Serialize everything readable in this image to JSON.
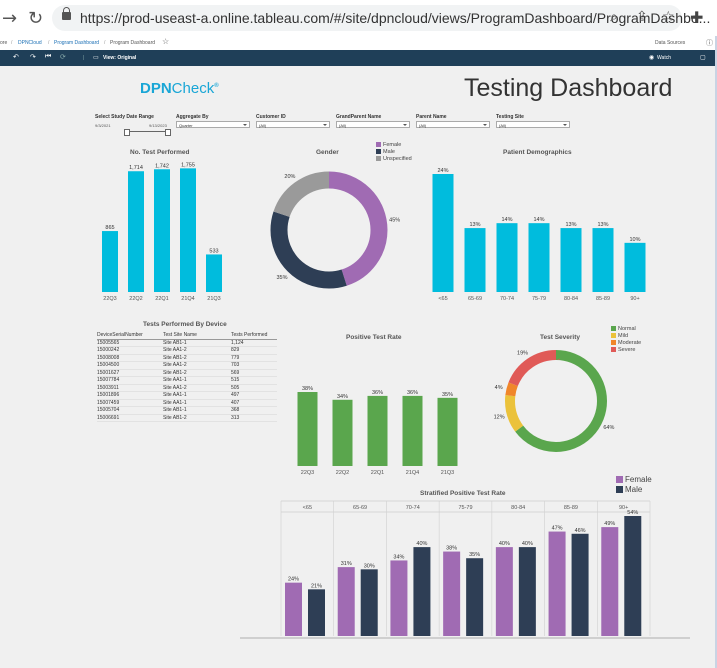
{
  "browser": {
    "url": "https://prod-useast-a.online.tableau.com/#/site/dpncloud/views/ProgramDashboard/ProgramDashbo..."
  },
  "breadcrumb": {
    "items": [
      "ore",
      "DPNCloud",
      "Program Dashboard",
      "Program Dashboard"
    ],
    "data_sources": "Data Sources"
  },
  "toolbar": {
    "view_label": "View: Original",
    "watch_label": "Watch"
  },
  "header": {
    "logo_a": "DPN",
    "logo_b": "Check",
    "logo_mark": "®",
    "title": "Testing Dashboard"
  },
  "filters": {
    "date_range": {
      "label": "Select Study Date Range",
      "start": "9/3/2021",
      "end": "9/13/2023"
    },
    "aggregate": {
      "label": "Aggregate By",
      "value": "Quarter"
    },
    "customer": {
      "label": "Customer ID",
      "value": "(All)"
    },
    "grandparent": {
      "label": "GrandParent Name",
      "value": "(All)"
    },
    "parent": {
      "label": "Parent Name",
      "value": "(All)"
    },
    "site": {
      "label": "Testing Site",
      "value": "(All)"
    }
  },
  "colors": {
    "cyan": "#00bcdd",
    "green": "#5aa64d",
    "purple": "#a06bb3",
    "navy": "#2e3e55",
    "gray": "#9a9a9a",
    "yellow": "#ebc23b",
    "orange": "#f0862a",
    "red": "#e05a57"
  },
  "chart_data": [
    {
      "id": "tests",
      "type": "bar",
      "title": "No. Test Performed",
      "categories": [
        "22Q3",
        "22Q2",
        "22Q1",
        "21Q4",
        "21Q3"
      ],
      "values": [
        865,
        1714,
        1742,
        1755,
        533
      ],
      "labels": [
        "865",
        "1,714",
        "1,742",
        "1,755",
        "533"
      ]
    },
    {
      "id": "gender",
      "type": "pie",
      "title": "Gender",
      "categories": [
        "Female",
        "Male",
        "Unspecified"
      ],
      "values": [
        45,
        35,
        20
      ],
      "labels": [
        "45%",
        "35%",
        "20%"
      ]
    },
    {
      "id": "demographics",
      "type": "bar",
      "title": "Patient Demographics",
      "categories": [
        "<65",
        "65-69",
        "70-74",
        "75-79",
        "80-84",
        "85-89",
        "90+"
      ],
      "values": [
        24,
        13,
        14,
        14,
        13,
        13,
        10
      ],
      "labels": [
        "24%",
        "13%",
        "14%",
        "14%",
        "13%",
        "13%",
        "10%"
      ]
    },
    {
      "id": "device",
      "type": "table",
      "title": "Tests Performed By Device",
      "columns": [
        "DeviceSerialNumber",
        "Test Site Name",
        "Tests Performed"
      ],
      "rows": [
        [
          "15005565",
          "Site AB1-1",
          "1,124"
        ],
        [
          "15000242",
          "Site AA1-2",
          "829"
        ],
        [
          "15008008",
          "Site AB1-2",
          "779"
        ],
        [
          "15004500",
          "Site AA1-2",
          "703"
        ],
        [
          "15001627",
          "Site AB1-2",
          "569"
        ],
        [
          "15007784",
          "Site AA1-1",
          "515"
        ],
        [
          "15003911",
          "Site AA1-2",
          "505"
        ],
        [
          "15001896",
          "Site AA1-1",
          "497"
        ],
        [
          "15007459",
          "Site AA1-1",
          "407"
        ],
        [
          "15005704",
          "Site AB1-1",
          "368"
        ],
        [
          "15006691",
          "Site AB1-2",
          "313"
        ]
      ]
    },
    {
      "id": "positive",
      "type": "bar",
      "title": "Positive Test Rate",
      "categories": [
        "22Q3",
        "22Q2",
        "22Q1",
        "21Q4",
        "21Q3"
      ],
      "values": [
        38,
        34,
        36,
        36,
        35
      ],
      "labels": [
        "38%",
        "34%",
        "36%",
        "36%",
        "35%"
      ]
    },
    {
      "id": "severity",
      "type": "pie",
      "title": "Test Severity",
      "categories": [
        "Normal",
        "Mild",
        "Moderate",
        "Severe"
      ],
      "values": [
        64,
        12,
        4,
        19
      ],
      "labels": [
        "64%",
        "12%",
        "4%",
        "19%"
      ]
    },
    {
      "id": "stratified",
      "type": "bar",
      "title": "Stratified Positive Test Rate",
      "categories": [
        "<65",
        "65-69",
        "70-74",
        "75-79",
        "80-84",
        "85-89",
        "90+"
      ],
      "series": [
        {
          "name": "Female",
          "values": [
            24,
            31,
            34,
            38,
            40,
            47,
            49
          ],
          "labels": [
            "24%",
            "31%",
            "34%",
            "38%",
            "40%",
            "47%",
            "49%"
          ]
        },
        {
          "name": "Male",
          "values": [
            21,
            30,
            40,
            35,
            40,
            46,
            54
          ],
          "labels": [
            "21%",
            "30%",
            "40%",
            "35%",
            "40%",
            "46%",
            "54%"
          ]
        }
      ]
    }
  ]
}
